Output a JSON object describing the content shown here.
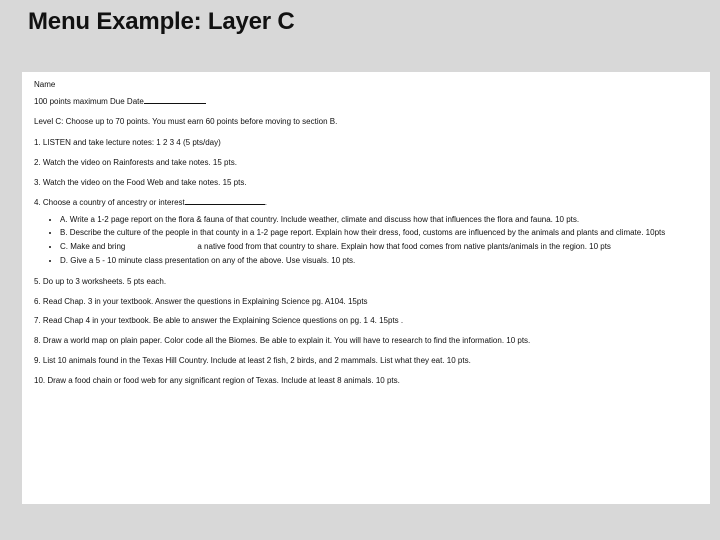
{
  "title": "Menu Example: Layer C",
  "name_label": "Name",
  "points_due": "100 points maximum Due Date",
  "level_instr": "Level C: Choose up to 70 points.  You must earn 60 points before moving to section B.",
  "items": {
    "i1": "1. LISTEN and take lecture notes: 1 2 3 4 (5 pts/day)",
    "i2": "2. Watch the video on Rainforests and take notes. 15 pts.",
    "i3": "3. Watch the video on the Food Web and take notes. 15 pts.",
    "i4_prefix": "4. Choose a country of ancestry or interest",
    "i4_suffix": ".",
    "i5": "5. Do up to 3 worksheets. 5 pts each.",
    "i6": "6. Read Chap.  3 in your textbook. Answer the questions in Explaining Science pg. A104. 15pts",
    "i7": "7. Read Chap 4 in your textbook. Be able to answer the Explaining Science questions on pg. 1   4. 15pts .",
    "i8": "8. Draw a world map on plain paper. Color code all the Biomes. Be able to explain it.  You will have to research to find the information. 10 pts.",
    "i9": "9. List 10 animals found in the Texas Hill Country. Include at least 2 fish, 2 birds, and 2 mammals. List what they eat. 10 pts.",
    "i10": "10. Draw a food chain or food web for any significant region of Texas. Include at least 8 animals. 10 pts."
  },
  "sub": {
    "a": "A. Write a 1-2 page report on the flora & fauna of that country. Include weather, climate and discuss how that influences the flora and fauna. 10 pts.",
    "b": "B. Describe the culture of the people in that county in a 1-2 page report. Explain how their dress, food, customs are influenced by the animals and plants and climate. 10pts",
    "c_before": "C. Make and bring",
    "c_after": "a native food from that country to share. Explain how that food comes from native plants/animals in the region. 10 pts",
    "d": "D. Give a 5 - 10 minute class presentation on any of the above. Use visuals. 10 pts."
  }
}
